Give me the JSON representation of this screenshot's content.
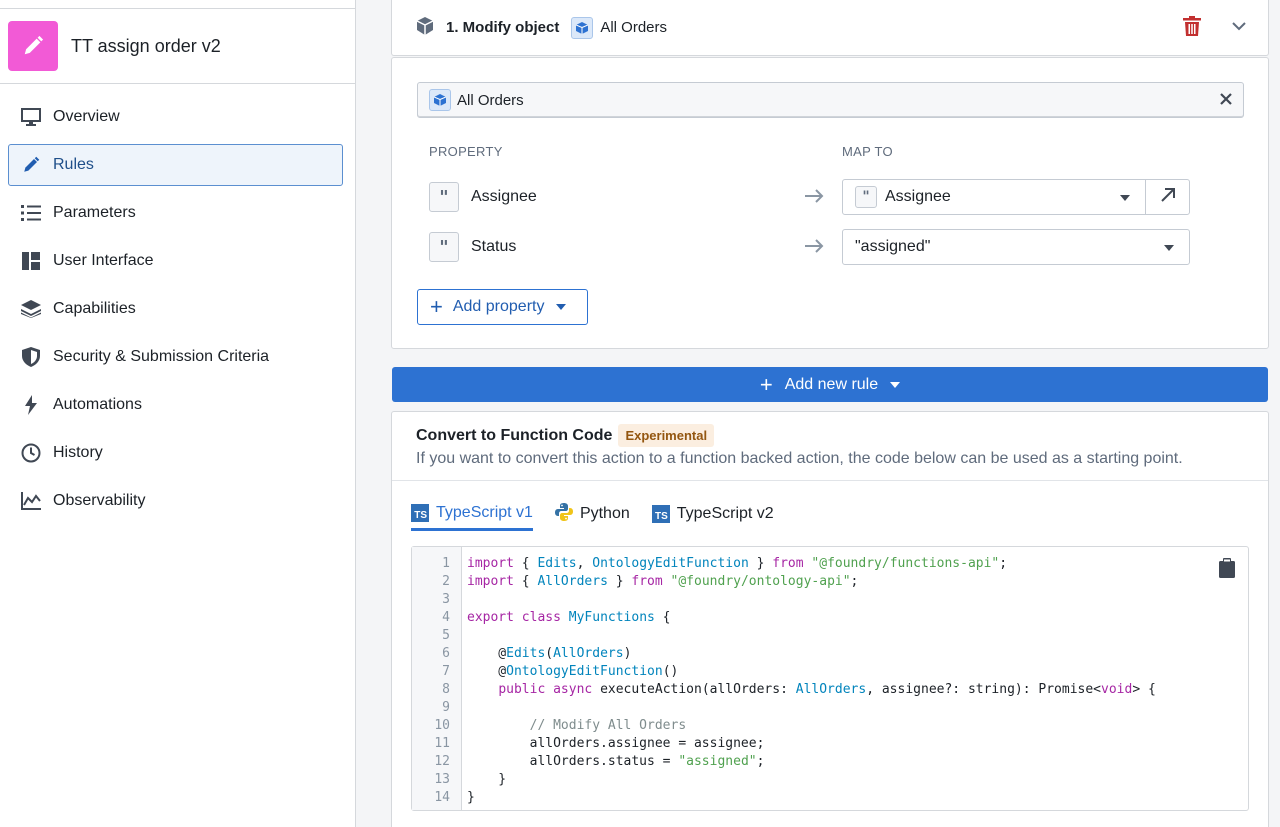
{
  "app": {
    "title": "TT assign order v2",
    "icon": "pencil-icon",
    "accent": "#f25ad6"
  },
  "nav": {
    "items": [
      {
        "label": "Overview",
        "icon": "monitor-icon"
      },
      {
        "label": "Rules",
        "icon": "pencil-icon",
        "active": true
      },
      {
        "label": "Parameters",
        "icon": "list-icon"
      },
      {
        "label": "User Interface",
        "icon": "layout-icon"
      },
      {
        "label": "Capabilities",
        "icon": "layers-icon"
      },
      {
        "label": "Security & Submission Criteria",
        "icon": "shield-icon"
      },
      {
        "label": "Automations",
        "icon": "lightning-icon"
      },
      {
        "label": "History",
        "icon": "clock-icon"
      },
      {
        "label": "Observability",
        "icon": "chart-icon"
      }
    ]
  },
  "rule": {
    "title": "1. Modify object",
    "object": "All Orders",
    "selected_object": "All Orders",
    "property_header": "PROPERTY",
    "map_header": "MAP TO",
    "properties": [
      {
        "name": "Assignee",
        "value": "Assignee"
      },
      {
        "name": "Status",
        "value": "\"assigned\""
      }
    ],
    "add_property_label": "Add property"
  },
  "add_rule_label": "Add new rule",
  "function_code": {
    "title": "Convert to Function Code",
    "badge": "Experimental",
    "description": "If you want to convert this action to a function backed action, the code below can be used as a starting point.",
    "tabs": [
      "TypeScript v1",
      "Python",
      "TypeScript v2"
    ],
    "active_tab": "TypeScript v1",
    "lines": [
      "import { Edits, OntologyEditFunction } from \"@foundry/functions-api\";",
      "import { AllOrders } from \"@foundry/ontology-api\";",
      "",
      "export class MyFunctions {",
      "",
      "    @Edits(AllOrders)",
      "    @OntologyEditFunction()",
      "    public async executeAction(allOrders: AllOrders, assignee?: string): Promise<void> {",
      "",
      "        // Modify All Orders",
      "        allOrders.assignee = assignee;",
      "        allOrders.status = \"assigned\";",
      "    }",
      "}"
    ]
  },
  "colors": {
    "primary": "#2d72d2",
    "danger": "#c23030"
  }
}
